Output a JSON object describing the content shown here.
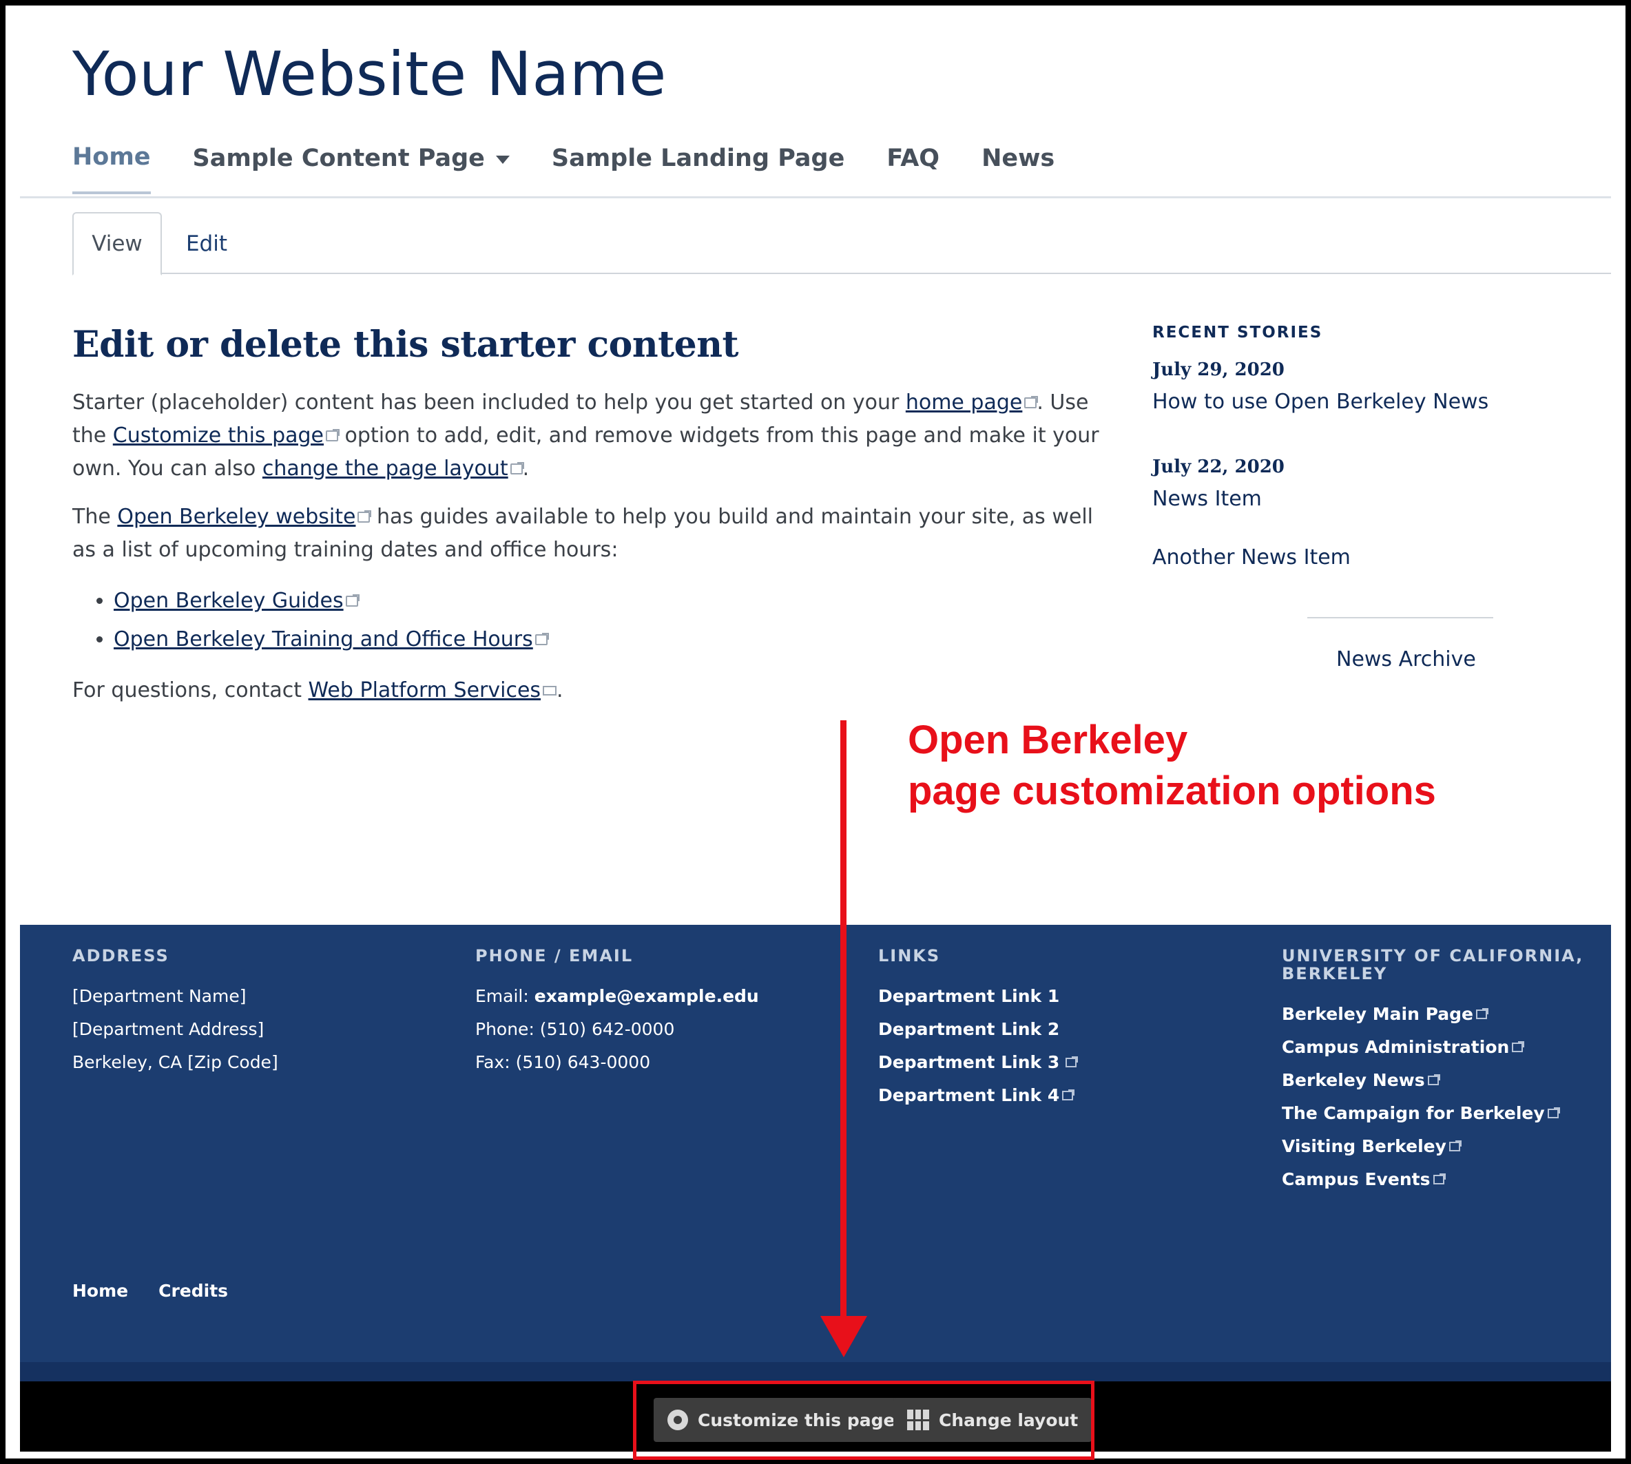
{
  "site": {
    "title": "Your Website Name"
  },
  "nav": {
    "items": [
      "Home",
      "Sample Content Page",
      "Sample Landing Page",
      "FAQ",
      "News"
    ],
    "active": "Home"
  },
  "tabs": {
    "view": "View",
    "edit": "Edit"
  },
  "main": {
    "heading": "Edit or delete this starter content",
    "p1_a": "Starter (placeholder) content has been included to help you get started on your ",
    "p1_link1": "home page",
    "p1_b": ". Use the ",
    "p1_link2": "Customize this page",
    "p1_c": " option to add, edit, and remove widgets from this page and make it your own. You can also ",
    "p1_link3": "change the page layout",
    "p1_d": ".",
    "p2_a": "The ",
    "p2_link": "Open Berkeley website",
    "p2_b": " has guides available to help you build and maintain your site, as well as a list of upcoming training dates and office hours:",
    "list": [
      "Open Berkeley Guides",
      "Open Berkeley Training and Office Hours"
    ],
    "p3_a": "For questions, contact ",
    "p3_link": "Web Platform Services",
    "p3_b": "."
  },
  "sidebar": {
    "heading": "RECENT STORIES",
    "stories": [
      {
        "date": "July 29, 2020",
        "title": "How to use Open Berkeley News"
      },
      {
        "date": "July 22, 2020",
        "title": "News Item"
      },
      {
        "date": "",
        "title": "Another News Item"
      }
    ],
    "archive": "News Archive"
  },
  "annotation": {
    "line1": "Open Berkeley",
    "line2": "page customization options"
  },
  "footer": {
    "address": {
      "heading": "ADDRESS",
      "lines": [
        "[Department Name]",
        "[Department Address]",
        "Berkeley, CA [Zip Code]"
      ]
    },
    "contact": {
      "heading": "PHONE / EMAIL",
      "email_label": "Email: ",
      "email": "example@example.edu",
      "phone": "Phone: (510) 642-0000",
      "fax": "Fax: (510) 643-0000"
    },
    "links": {
      "heading": "LINKS",
      "items": [
        "Department Link 1",
        "Department Link 2",
        "Department Link 3",
        "Department Link 4"
      ]
    },
    "ucb": {
      "heading_1": "UNIVERSITY OF CALIFORNIA,",
      "heading_2": "BERKELEY",
      "items": [
        "Berkeley Main Page",
        "Campus Administration",
        "Berkeley News",
        "The Campaign for Berkeley",
        "Visiting Berkeley",
        "Campus Events"
      ]
    },
    "bottom_links": [
      "Home",
      "Credits"
    ]
  },
  "toolbar": {
    "customize": "Customize this page",
    "layout": "Change layout"
  },
  "icons": {
    "gear": "gear-icon",
    "layout": "layout-grid-icon"
  },
  "colors": {
    "brand": "#1c3d70",
    "title": "#0f2a57",
    "annotation": "#e8101a"
  }
}
